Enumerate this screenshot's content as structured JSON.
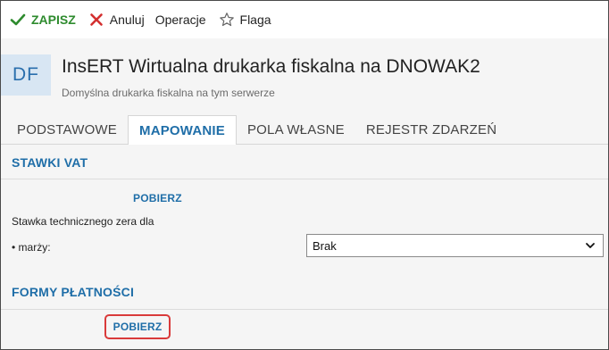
{
  "toolbar": {
    "save_label": "ZAPISZ",
    "cancel_label": "Anuluj",
    "operations_label": "Operacje",
    "flag_label": "Flaga"
  },
  "header": {
    "avatar_initials": "DF",
    "title": "InsERT Wirtualna drukarka fiskalna na DNOWAK2",
    "subtitle": "Domyślna drukarka fiskalna na tym serwerze"
  },
  "tabs": [
    {
      "label": "PODSTAWOWE",
      "active": false
    },
    {
      "label": "MAPOWANIE",
      "active": true
    },
    {
      "label": "POLA WŁASNE",
      "active": false
    },
    {
      "label": "REJESTR ZDARZEŃ",
      "active": false
    }
  ],
  "vat_section": {
    "title": "STAWKI VAT",
    "fetch_label": "POBIERZ",
    "zero_rate_label": "Stawka technicznego zera dla",
    "margin_label": "• marży:",
    "margin_select_value": "Brak"
  },
  "payment_section": {
    "title": "FORMY PŁATNOŚCI",
    "fetch_label": "POBIERZ"
  },
  "colors": {
    "accent": "#1f6ea8",
    "save_green": "#2e8b2e",
    "cancel_red": "#d32f2f",
    "highlight_red": "#d93a3a"
  }
}
